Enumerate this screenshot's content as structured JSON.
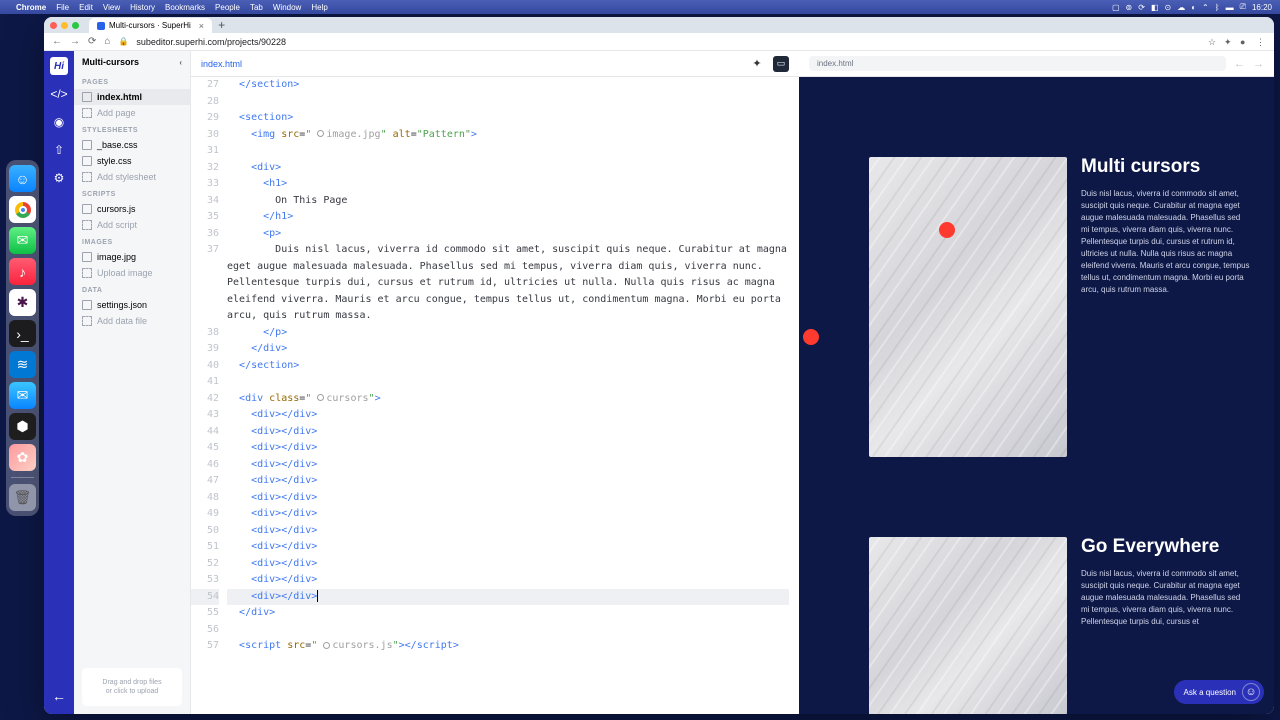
{
  "menubar": {
    "app": "Chrome",
    "items": [
      "File",
      "Edit",
      "View",
      "History",
      "Bookmarks",
      "People",
      "Tab",
      "Window",
      "Help"
    ],
    "time": "16:20"
  },
  "browser": {
    "tab_title": "Multi-cursors · SuperHi",
    "url": "subeditor.superhi.com/projects/90228"
  },
  "sidebar": {
    "project": "Multi-cursors",
    "sections": {
      "pages": {
        "label": "PAGES",
        "items": [
          "index.html"
        ],
        "add": "Add page"
      },
      "stylesheets": {
        "label": "STYLESHEETS",
        "items": [
          "_base.css",
          "style.css"
        ],
        "add": "Add stylesheet"
      },
      "scripts": {
        "label": "SCRIPTS",
        "items": [
          "cursors.js"
        ],
        "add": "Add script"
      },
      "images": {
        "label": "IMAGES",
        "items": [
          "image.jpg"
        ],
        "add": "Upload image"
      },
      "data": {
        "label": "DATA",
        "items": [
          "settings.json"
        ],
        "add": "Add data file"
      }
    },
    "dropzone_l1": "Drag and drop files",
    "dropzone_l2": "or click to upload"
  },
  "editor": {
    "tab": "index.html",
    "line_start": 27,
    "line_end": 57,
    "img_src": "image.jpg",
    "img_alt": "Pattern",
    "h1_text": "On This Page",
    "paragraph": "Duis nisl lacus, viverra id commodo sit amet, suscipit quis neque. Curabitur at magna eget augue malesuada malesuada. Phasellus sed mi tempus, viverra diam quis, viverra nunc. Pellentesque turpis dui, cursus et rutrum id, ultricies ut nulla. Nulla quis risus ac magna eleifend viverra. Mauris et arcu congue, tempus tellus ut, condimentum magna. Morbi eu porta arcu, quis rutrum massa.",
    "cursors_class": "cursors",
    "script_src": "cursors.js"
  },
  "preview": {
    "url": "index.html",
    "section1": {
      "title": "Multi cursors",
      "text": "Duis nisl lacus, viverra id commodo sit amet, suscipit quis neque. Curabitur at magna eget augue malesuada malesuada. Phasellus sed mi tempus, viverra diam quis, viverra nunc. Pellentesque turpis dui, cursus et rutrum id, ultricies ut nulla. Nulla quis risus ac magna eleifend viverra. Mauris et arcu congue, tempus tellus ut, condimentum magna. Morbi eu porta arcu, quis rutrum massa."
    },
    "section2": {
      "title": "Go Everywhere",
      "text": "Duis nisl lacus, viverra id commodo sit amet, suscipit quis neque. Curabitur at magna eget augue malesuada malesuada. Phasellus sed mi tempus, viverra diam quis, viverra nunc. Pellentesque turpis dui, cursus et"
    },
    "chat": "Ask a question"
  }
}
